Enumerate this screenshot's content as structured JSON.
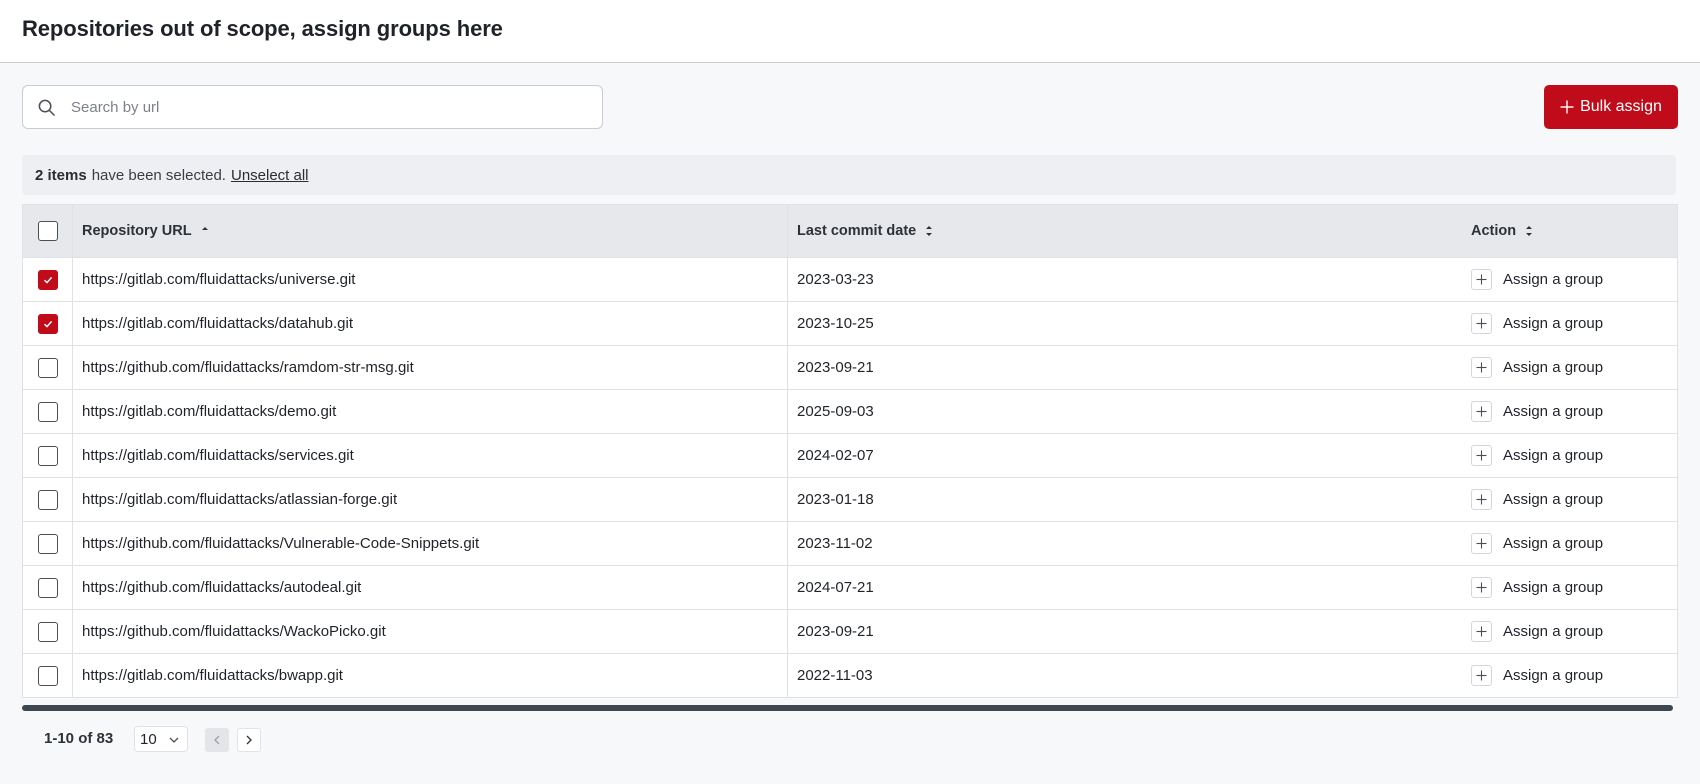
{
  "header": {
    "title": "Repositories out of scope, assign groups here"
  },
  "search": {
    "placeholder": "Search by url",
    "value": ""
  },
  "toolbar": {
    "bulk_assign_label": "Bulk assign"
  },
  "selection": {
    "count_text": "2 items",
    "message": "have been selected.",
    "unselect_label": "Unselect all"
  },
  "table": {
    "columns": [
      "Repository URL",
      "Last commit date",
      "Action"
    ],
    "rows": [
      {
        "checked": true,
        "url": "https://gitlab.com/fluidattacks/universe.git",
        "date": "2023-03-23",
        "action": "Assign a group"
      },
      {
        "checked": true,
        "url": "https://gitlab.com/fluidattacks/datahub.git",
        "date": "2023-10-25",
        "action": "Assign a group"
      },
      {
        "checked": false,
        "url": "https://github.com/fluidattacks/ramdom-str-msg.git",
        "date": "2023-09-21",
        "action": "Assign a group"
      },
      {
        "checked": false,
        "url": "https://gitlab.com/fluidattacks/demo.git",
        "date": "2025-09-03",
        "action": "Assign a group"
      },
      {
        "checked": false,
        "url": "https://gitlab.com/fluidattacks/services.git",
        "date": "2024-02-07",
        "action": "Assign a group"
      },
      {
        "checked": false,
        "url": "https://gitlab.com/fluidattacks/atlassian-forge.git",
        "date": "2023-01-18",
        "action": "Assign a group"
      },
      {
        "checked": false,
        "url": "https://github.com/fluidattacks/Vulnerable-Code-Snippets.git",
        "date": "2023-11-02",
        "action": "Assign a group"
      },
      {
        "checked": false,
        "url": "https://github.com/fluidattacks/autodeal.git",
        "date": "2024-07-21",
        "action": "Assign a group"
      },
      {
        "checked": false,
        "url": "https://github.com/fluidattacks/WackoPicko.git",
        "date": "2023-09-21",
        "action": "Assign a group"
      },
      {
        "checked": false,
        "url": "https://gitlab.com/fluidattacks/bwapp.git",
        "date": "2022-11-03",
        "action": "Assign a group"
      }
    ]
  },
  "pagination": {
    "range_text": "1-10 of 83",
    "page_size": "10"
  },
  "icons": {
    "search": "search-icon",
    "plus": "plus-icon",
    "sort": "sort-icon",
    "check": "check-icon",
    "chevron_down": "chevron-down-icon",
    "chevron_left": "chevron-left-icon",
    "chevron_right": "chevron-right-icon"
  },
  "colors": {
    "accent": "#bf0b1a",
    "header_bg": "#e7e8ec",
    "page_bg": "#f7f8fa"
  }
}
